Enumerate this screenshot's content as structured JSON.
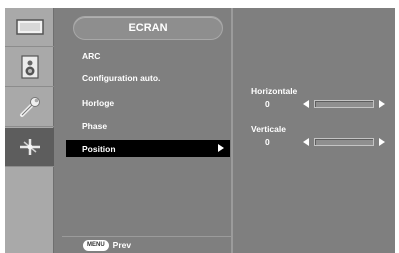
{
  "sidebar": {
    "icons": [
      {
        "name": "picture-icon",
        "active": false
      },
      {
        "name": "speaker-icon",
        "active": false
      },
      {
        "name": "wrench-icon",
        "active": false
      },
      {
        "name": "options-icon",
        "active": true
      }
    ]
  },
  "menu": {
    "title": "ECRAN",
    "items": [
      {
        "label": "ARC",
        "selected": false
      },
      {
        "label": "Configuration auto.",
        "selected": false
      },
      {
        "label": "Horloge",
        "selected": false
      },
      {
        "label": "Phase",
        "selected": false
      },
      {
        "label": "Position",
        "selected": true
      }
    ],
    "footer": {
      "button": "MENU",
      "label": "Prev"
    }
  },
  "adjust": {
    "horizontal": {
      "label": "Horizontale",
      "value": "0",
      "fraction": 0
    },
    "vertical": {
      "label": "Verticale",
      "value": "0",
      "fraction": 0
    }
  },
  "colors": {
    "panel": "#7f7f7f",
    "sidebar": "#a9a9a9",
    "selected": "#000000",
    "text": "#ffffff"
  }
}
